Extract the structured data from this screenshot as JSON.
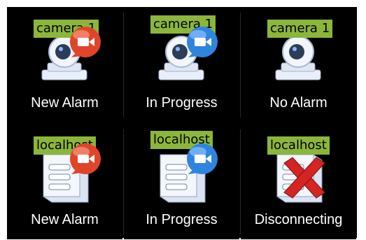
{
  "tiles": [
    {
      "tag": "camera 1",
      "device": "camera",
      "status": "new-alarm",
      "caption": "New Alarm"
    },
    {
      "tag": "camera 1",
      "device": "camera",
      "status": "in-progress",
      "caption": "In Progress"
    },
    {
      "tag": "camera 1",
      "device": "camera",
      "status": "no-alarm",
      "caption": "No Alarm"
    },
    {
      "tag": "localhost",
      "device": "server",
      "status": "new-alarm",
      "caption": "New Alarm"
    },
    {
      "tag": "localhost",
      "device": "server",
      "status": "in-progress",
      "caption": "In Progress"
    },
    {
      "tag": "localhost",
      "device": "server",
      "status": "disconnected",
      "caption": "Disconnecting"
    }
  ],
  "colors": {
    "background": "#000000",
    "tag": "#8bb63b",
    "alarm_badge": "#e0452a",
    "progress_badge": "#2f84e0",
    "error_x": "#d42424"
  }
}
